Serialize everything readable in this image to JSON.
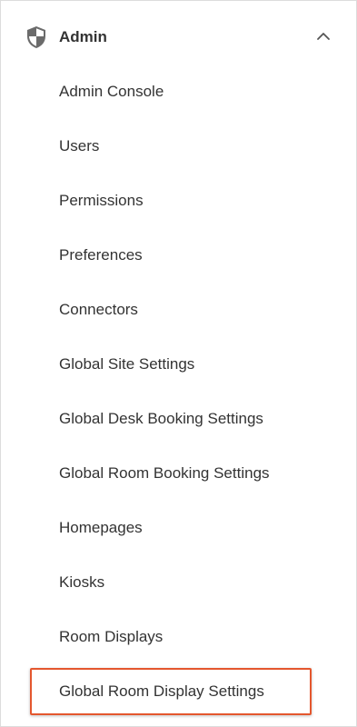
{
  "section": {
    "title": "Admin",
    "icon": "shield-icon",
    "toggle_icon": "chevron-up-icon",
    "expanded": true
  },
  "items": [
    {
      "label": "Admin Console"
    },
    {
      "label": "Users"
    },
    {
      "label": "Permissions"
    },
    {
      "label": "Preferences"
    },
    {
      "label": "Connectors"
    },
    {
      "label": "Global Site Settings"
    },
    {
      "label": "Global Desk Booking Settings"
    },
    {
      "label": "Global Room Booking Settings"
    },
    {
      "label": "Homepages"
    },
    {
      "label": "Kiosks"
    },
    {
      "label": "Room Displays"
    },
    {
      "label": "Global Room Display Settings",
      "highlighted": true
    }
  ],
  "colors": {
    "highlight_border": "#e4572e",
    "text": "#333333",
    "icon": "#6b6b6b"
  }
}
